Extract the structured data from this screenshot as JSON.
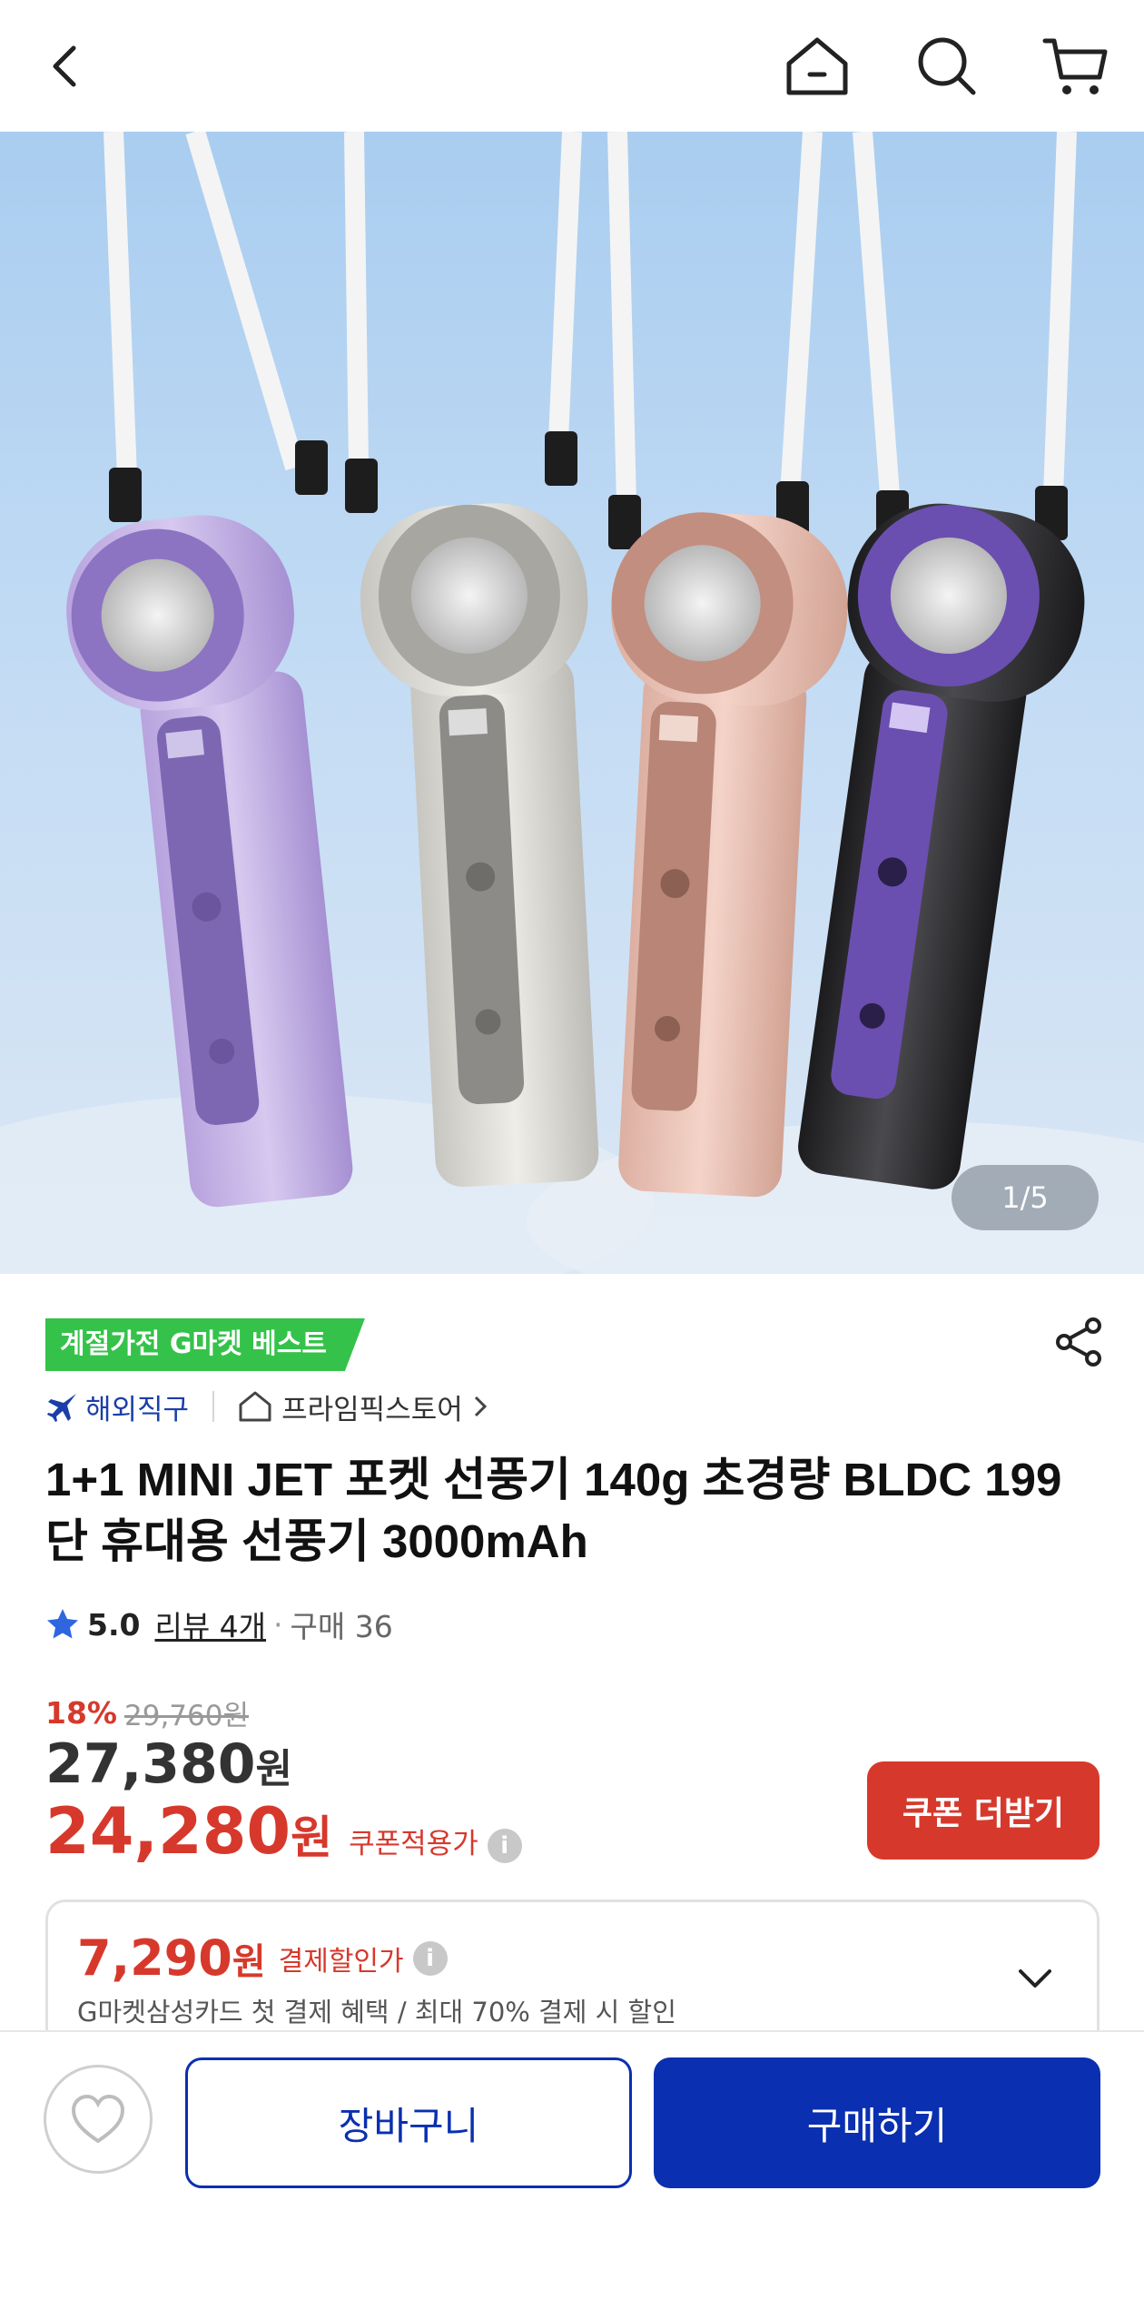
{
  "header": {
    "icons": [
      "back-icon",
      "home-icon",
      "search-icon",
      "cart-icon"
    ]
  },
  "gallery": {
    "pager": "1/5",
    "fan_colors": [
      "#c9b7e6",
      "#d9d8d4",
      "#e9c4b8",
      "#2c2c2e"
    ]
  },
  "product": {
    "best_badge": "계절가전 G마켓 베스트",
    "overseas_label": "해외직구",
    "store_name": "프라임픽스토어",
    "title": "1+1 MINI JET 포켓 선풍기 140g 초경량 BLDC 199단 휴대용 선풍기 3000mAh",
    "rating": "5.0",
    "reviews": "리뷰 4개",
    "separator": "·",
    "purchases": "구매 36"
  },
  "pricing": {
    "discount_rate": "18%",
    "original_price": "29,760원",
    "price_value": "27,380",
    "price_unit": "원",
    "coupon_price_value": "24,280",
    "coupon_price_unit": "원",
    "coupon_label": "쿠폰적용가",
    "info_glyph": "i",
    "coupon_button": "쿠폰 더받기"
  },
  "card_benefit": {
    "amount_value": "7,290",
    "amount_unit": "원",
    "label": "결제할인가",
    "info_glyph": "i",
    "description": "G마켓삼성카드 첫 결제 혜택 / 최대 70% 결제 시 할인"
  },
  "bottom_bar": {
    "cart_button": "장바구니",
    "buy_button": "구매하기"
  },
  "colors": {
    "accent_red": "#d6392c",
    "brand_blue": "#0a2fb0",
    "badge_green": "#35c24a"
  }
}
